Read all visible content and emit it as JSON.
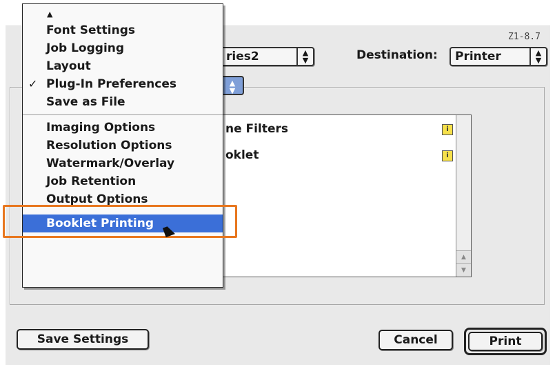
{
  "version": "Z1-8.7",
  "printer_popup": {
    "value_fragment": "ries2"
  },
  "destination": {
    "label": "Destination:",
    "value": "Printer"
  },
  "list": {
    "items": [
      {
        "label": "ne Filters"
      },
      {
        "label": "oklet"
      }
    ],
    "info_icon_glyph": "i"
  },
  "menu": {
    "scroll_up_arrow": "▲",
    "check_mark": "✓",
    "group1": [
      {
        "label": "Font Settings"
      },
      {
        "label": "Job Logging"
      },
      {
        "label": "Layout"
      },
      {
        "label": "Plug-In Preferences",
        "checked": true
      },
      {
        "label": "Save as File"
      }
    ],
    "group2": [
      {
        "label": "Imaging Options"
      },
      {
        "label": "Resolution Options"
      },
      {
        "label": "Watermark/Overlay"
      },
      {
        "label": "Job Retention"
      },
      {
        "label": "Output Options"
      },
      {
        "label": "Booklet Printing",
        "selected": true
      }
    ]
  },
  "buttons": {
    "save_settings": "Save Settings",
    "cancel": "Cancel",
    "print": "Print"
  },
  "colors": {
    "selection": "#3b6fd8",
    "highlight_outline": "#e8771f"
  }
}
